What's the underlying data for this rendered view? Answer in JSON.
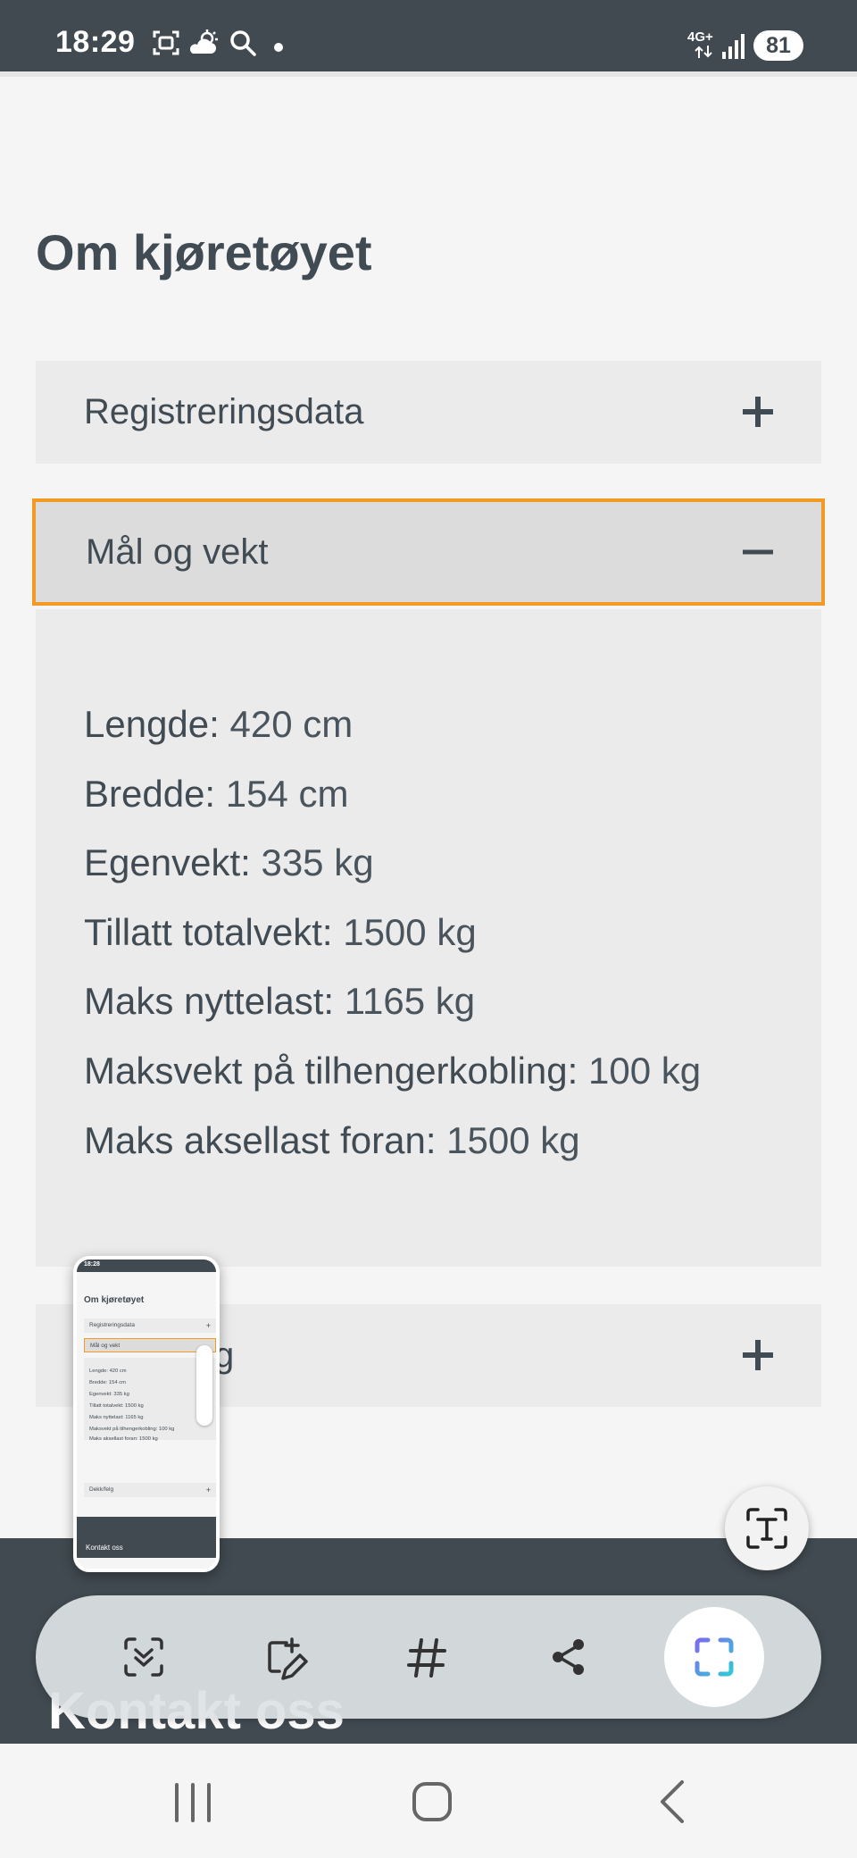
{
  "status_bar": {
    "time": "18:29",
    "network": "4G+",
    "battery": "81"
  },
  "page": {
    "section_title": "Om kjøretøyet",
    "accordion": [
      {
        "label": "Registreringsdata",
        "state": "collapsed"
      },
      {
        "label": "Mål og vekt",
        "state": "expanded"
      },
      {
        "label": "g",
        "state": "collapsed"
      }
    ],
    "specs": [
      {
        "label": "Lengde:",
        "value": "420 cm"
      },
      {
        "label": "Bredde:",
        "value": "154 cm"
      },
      {
        "label": "Egenvekt:",
        "value": "335 kg"
      },
      {
        "label": "Tillatt totalvekt:",
        "value": "1500 kg"
      },
      {
        "label": "Maks nyttelast:",
        "value": "1165 kg"
      },
      {
        "label": "Maksvekt på tilhengerkobling:",
        "value": "100 kg"
      },
      {
        "label": "Maks aksellast foran:",
        "value": "1500 kg"
      }
    ],
    "footer_title": "Kontakt oss"
  },
  "thumbnail": {
    "time": "18:28",
    "title": "Om kjøretøyet",
    "acc_1": "Registreringsdata",
    "acc_2": "Mål og vekt",
    "acc_3": "Dekk/felg",
    "specs": [
      "Lengde: 420 cm",
      "Bredde: 154 cm",
      "Egenvekt: 335 kg",
      "Tillatt totalvekt: 1500 kg",
      "Maks nyttelast: 1165 kg",
      "Maksvekt på tilhengerkobling: 100 kg",
      "Maks aksellast foran: 1500 kg"
    ],
    "footer": "Kontakt oss"
  },
  "toolbar": {
    "icons": [
      "scroll-capture-icon",
      "edit-icon",
      "hashtag-icon",
      "share-icon",
      "crop-frame-icon"
    ],
    "active": "crop-frame-icon"
  },
  "colors": {
    "header_dark": "#414a51",
    "accent_focus": "#f29a24",
    "accordion_bg": "#ebebeb",
    "text": "#414b53"
  }
}
